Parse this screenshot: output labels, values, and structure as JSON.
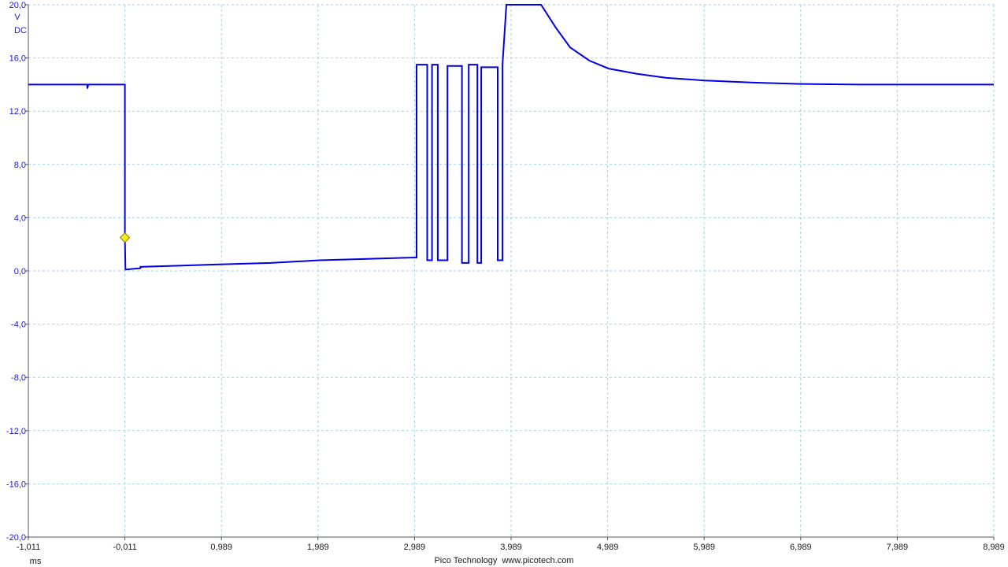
{
  "chart_data": {
    "type": "line",
    "title": "",
    "xlabel": "ms",
    "ylabel": "V",
    "y_unit": "V",
    "coupling": "DC",
    "xlim": [
      -1.011,
      8.989
    ],
    "ylim": [
      -20.0,
      20.0
    ],
    "x_ticks": [
      "-1,011",
      "-0,011",
      "0,989",
      "1,989",
      "2,989",
      "3,989",
      "4,989",
      "5,989",
      "6,989",
      "7,989",
      "8,989"
    ],
    "y_ticks": [
      "20,0",
      "16,0",
      "12,0",
      "8,0",
      "4,0",
      "0,0",
      "-4,0",
      "-8,0",
      "-12,0",
      "-16,0",
      "-20,0"
    ],
    "grid": true,
    "grid_style": "dashed",
    "trace_color": "#0000e6",
    "grid_color": "#a6d2e0",
    "trigger": {
      "x": -0.011,
      "y": 2.5,
      "color": "#f2ea1a"
    },
    "series": [
      {
        "x": [
          -1.011,
          -0.4,
          -0.4,
          -0.39,
          -0.02,
          -0.011,
          -0.011,
          -0.011,
          -0.005,
          0.15,
          0.15,
          1.0,
          1.5,
          2.0,
          2.5,
          2.96,
          3.01,
          3.01,
          3.12,
          3.12,
          3.17,
          3.17,
          3.23,
          3.23,
          3.33,
          3.33,
          3.48,
          3.48,
          3.55,
          3.55,
          3.64,
          3.64,
          3.68,
          3.68,
          3.85,
          3.85,
          3.9,
          3.9,
          3.94,
          4.1,
          4.3,
          4.45,
          4.6,
          4.8,
          5.0,
          5.3,
          5.6,
          6.0,
          6.5,
          7.0,
          7.6,
          8.2,
          8.989
        ],
        "y": [
          14.0,
          14.0,
          13.7,
          14.0,
          14.0,
          14.0,
          8.0,
          2.5,
          0.1,
          0.2,
          0.3,
          0.5,
          0.6,
          0.8,
          0.9,
          1.0,
          1.0,
          15.5,
          15.5,
          0.8,
          0.8,
          15.5,
          15.5,
          0.8,
          0.8,
          15.4,
          15.4,
          0.6,
          0.6,
          15.5,
          15.5,
          0.6,
          0.6,
          15.3,
          15.3,
          0.8,
          0.8,
          15.5,
          20.0,
          20.0,
          20.0,
          18.3,
          16.8,
          15.8,
          15.2,
          14.8,
          14.5,
          14.3,
          14.15,
          14.05,
          14.0,
          14.0,
          14.0
        ]
      }
    ]
  },
  "footer": {
    "x_unit": "ms",
    "credit": "Pico Technology  www.picotech.com"
  }
}
